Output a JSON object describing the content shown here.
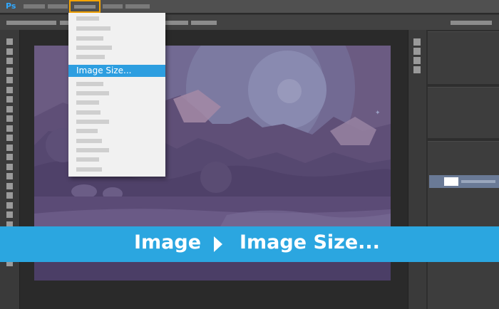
{
  "app": {
    "logo_text": "Ps"
  },
  "menubar": {
    "active_menu": "Image"
  },
  "image_menu": {
    "selected_item_label": "Image Size..."
  },
  "breadcrumb": {
    "step1": "Image",
    "step2": "Image Size..."
  },
  "colors": {
    "accent": "#2ba6e0",
    "menu_highlight": "#f7a400",
    "canvas": "#695a80"
  }
}
